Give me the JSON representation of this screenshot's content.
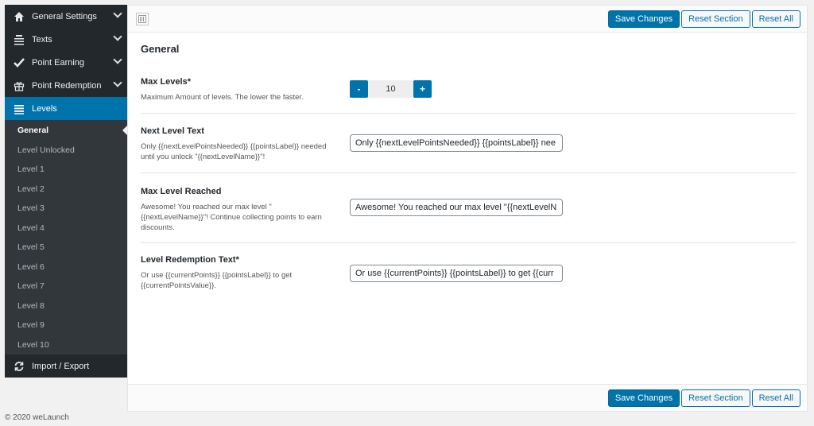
{
  "sidebar": {
    "menu": [
      {
        "label": "General Settings",
        "icon": "home-icon"
      },
      {
        "label": "Texts",
        "icon": "text-align-icon"
      },
      {
        "label": "Point Earning",
        "icon": "checkmark-icon"
      },
      {
        "label": "Point Redemption",
        "icon": "gift-icon"
      },
      {
        "label": "Levels",
        "icon": "list-icon"
      }
    ],
    "submenu": [
      "General",
      "Level Unlocked",
      "Level 1",
      "Level 2",
      "Level 3",
      "Level 4",
      "Level 5",
      "Level 6",
      "Level 7",
      "Level 8",
      "Level 9",
      "Level 10"
    ],
    "import_export": {
      "label": "Import / Export",
      "icon": "refresh-icon"
    }
  },
  "toolbar": {
    "save_label": "Save Changes",
    "reset_section_label": "Reset Section",
    "reset_all_label": "Reset All"
  },
  "section": {
    "title": "General",
    "fields": {
      "max_levels": {
        "label": "Max Levels*",
        "desc": "Maximum Amount of levels. The lower the faster.",
        "value": "10",
        "minus": "-",
        "plus": "+"
      },
      "next_level": {
        "label": "Next Level Text",
        "desc": "Only {{nextLevelPointsNeeded}} {{pointsLabel}} needed until you unlock \"{{nextLevelName}}\"!",
        "value": "Only {{nextLevelPointsNeeded}} {{pointsLabel}} nee"
      },
      "max_reached": {
        "label": "Max Level Reached",
        "desc": "Awesome! You reached our max level \"{{nextLevelName}}\"! Continue collecting points to earn discounts.",
        "value": "Awesome! You reached our max level \"{{nextLevelN..."
      },
      "redemption": {
        "label": "Level Redemption Text*",
        "desc": "Or use {{currentPoints}} {{pointsLabel}} to get {{currentPointsValue}}.",
        "value": "Or use {{currentPoints}} {{pointsLabel}} to get {{curr"
      }
    }
  },
  "footer": {
    "copyright": "© 2020 weLaunch"
  },
  "colors": {
    "accent": "#0073aa",
    "sidebar_bg": "#23282d",
    "submenu_bg": "#32373c"
  }
}
